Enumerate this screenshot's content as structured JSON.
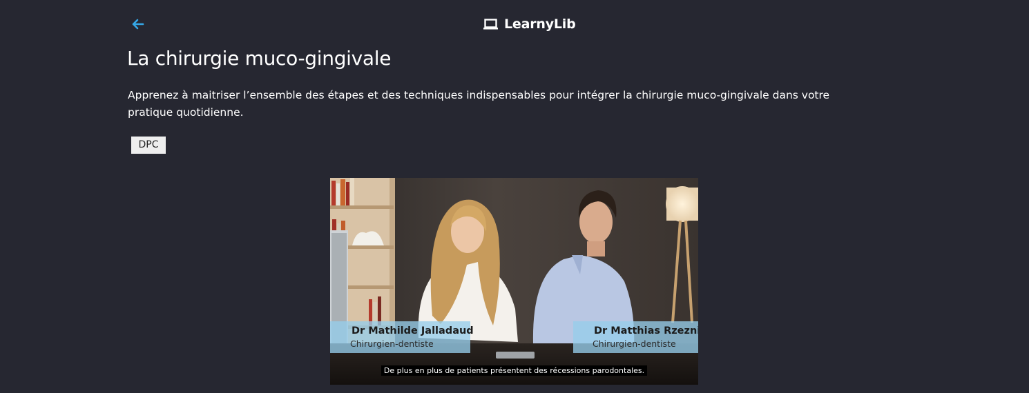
{
  "header": {
    "brand": "LearnyLib",
    "back_icon": "arrow-left-icon",
    "brand_icon": "laptop-icon",
    "accent_color": "#35a7e6"
  },
  "course": {
    "title": "La chirurgie muco-gingivale",
    "description": "Apprenez à maitriser l’ensemble des étapes et des techniques indispensables pour intégrer la chirurgie muco-gingivale dans votre pratique quotidienne.",
    "badge": "DPC"
  },
  "video": {
    "speakers": [
      {
        "name": "Dr Mathilde Jalladaud",
        "role": "Chirurgien-dentiste"
      },
      {
        "name": "Dr Matthias Rzeznik",
        "role": "Chirurgien-dentiste"
      }
    ],
    "caption": "De plus en plus de patients présentent des récessions parodontales."
  }
}
